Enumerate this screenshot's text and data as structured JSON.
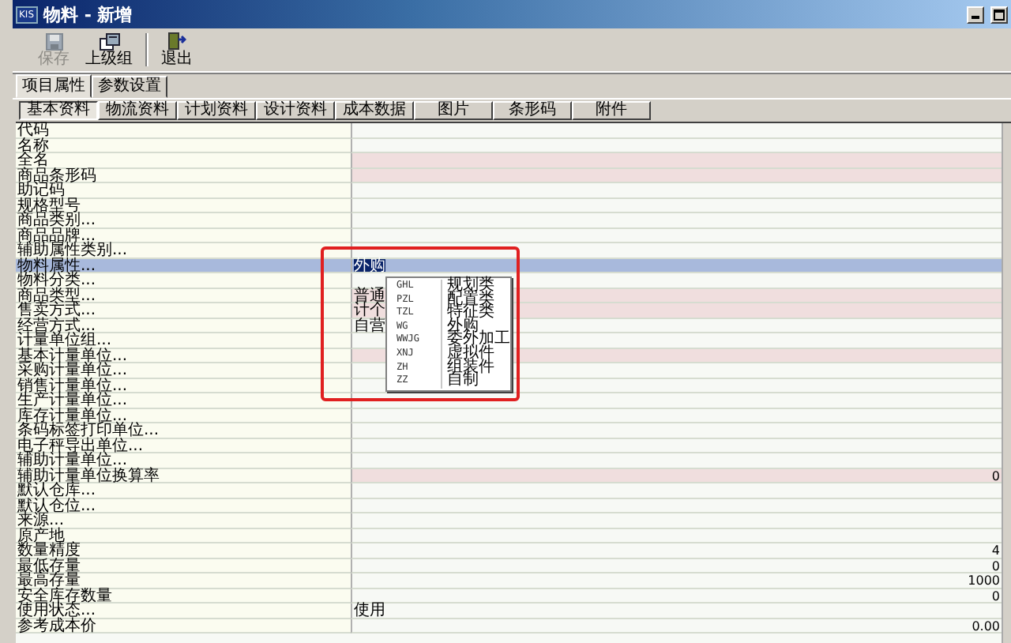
{
  "window": {
    "icon_text": "KIS",
    "title": "物料 - 新增"
  },
  "toolbar": [
    {
      "label": "保存",
      "disabled": true
    },
    {
      "label": "上级组",
      "disabled": false
    },
    {
      "label": "退出",
      "disabled": false
    }
  ],
  "tabs": [
    {
      "label": "项目属性",
      "selected": true
    },
    {
      "label": "参数设置",
      "selected": false
    }
  ],
  "subtabs": [
    {
      "label": "基本资料",
      "selected": true
    },
    {
      "label": "物流资料",
      "selected": false
    },
    {
      "label": "计划资料",
      "selected": false
    },
    {
      "label": "设计资料",
      "selected": false
    },
    {
      "label": "成本数据",
      "selected": false
    },
    {
      "label": "图片",
      "selected": false
    },
    {
      "label": "条形码",
      "selected": false
    },
    {
      "label": "附件",
      "selected": false
    }
  ],
  "fields": [
    {
      "label": "代码",
      "kind": "text",
      "required": false,
      "selected": false
    },
    {
      "label": "名称",
      "kind": "text",
      "required": false,
      "selected": false
    },
    {
      "label": "全名",
      "kind": "text",
      "required": true,
      "selected": false
    },
    {
      "label": "商品条形码",
      "kind": "text",
      "required": true,
      "selected": false
    },
    {
      "label": "助记码",
      "kind": "text",
      "required": false,
      "selected": false
    },
    {
      "label": "规格型号",
      "kind": "text",
      "required": false,
      "selected": false
    },
    {
      "label": "商品类别...",
      "kind": "text",
      "required": false,
      "selected": false
    },
    {
      "label": "商品品牌...",
      "kind": "text",
      "required": false,
      "selected": false
    },
    {
      "label": "辅助属性类别...",
      "kind": "text",
      "required": false,
      "selected": false
    },
    {
      "label": "物料属性...",
      "kind": "text",
      "value": "外购",
      "required": false,
      "selected": true
    },
    {
      "label": "物料分类...",
      "kind": "text",
      "required": false,
      "selected": false
    },
    {
      "label": "商品类型...",
      "kind": "text",
      "value": "普通",
      "required": true,
      "selected": false
    },
    {
      "label": "售卖方式...",
      "kind": "text",
      "value": "计个",
      "required": true,
      "selected": false
    },
    {
      "label": "经营方式...",
      "kind": "text",
      "value": "自营",
      "required": false,
      "selected": false
    },
    {
      "label": "计量单位组...",
      "kind": "text",
      "required": false,
      "selected": false
    },
    {
      "label": "基本计量单位...",
      "kind": "text",
      "required": true,
      "selected": false
    },
    {
      "label": "采购计量单位...",
      "kind": "text",
      "required": false,
      "selected": false
    },
    {
      "label": "销售计量单位...",
      "kind": "text",
      "required": false,
      "selected": false
    },
    {
      "label": "生产计量单位...",
      "kind": "text",
      "required": false,
      "selected": false
    },
    {
      "label": "库存计量单位...",
      "kind": "text",
      "required": false,
      "selected": false
    },
    {
      "label": "条码标签打印单位...",
      "kind": "text",
      "required": false,
      "selected": false
    },
    {
      "label": "电子秤导出单位...",
      "kind": "text",
      "required": false,
      "selected": false
    },
    {
      "label": "辅助计量单位...",
      "kind": "text",
      "required": false,
      "selected": false
    },
    {
      "label": "辅助计量单位换算率",
      "kind": "number",
      "value": "0",
      "required": true,
      "selected": false
    },
    {
      "label": "默认仓库...",
      "kind": "text",
      "required": false,
      "selected": false
    },
    {
      "label": "默认仓位...",
      "kind": "text",
      "required": false,
      "selected": false
    },
    {
      "label": "来源...",
      "kind": "text",
      "required": false,
      "selected": false
    },
    {
      "label": "原产地",
      "kind": "text",
      "required": false,
      "selected": false
    },
    {
      "label": "数量精度",
      "kind": "number",
      "value": "4",
      "required": false,
      "selected": false
    },
    {
      "label": "最低存量",
      "kind": "number",
      "value": "0",
      "required": false,
      "selected": false
    },
    {
      "label": "最高存量",
      "kind": "number",
      "value": "1000",
      "required": false,
      "selected": false
    },
    {
      "label": "安全库存数量",
      "kind": "number",
      "value": "0",
      "required": false,
      "selected": false
    },
    {
      "label": "使用状态...",
      "kind": "text",
      "value": "使用",
      "required": false,
      "selected": false
    },
    {
      "label": "参考成本价",
      "kind": "number",
      "value": "0.00",
      "required": false,
      "selected": false
    }
  ],
  "dropdown": {
    "items": [
      {
        "code": "GHL",
        "name": "规划类"
      },
      {
        "code": "PZL",
        "name": "配置类"
      },
      {
        "code": "TZL",
        "name": "特征类"
      },
      {
        "code": "WG",
        "name": "外购"
      },
      {
        "code": "WWJG",
        "name": "委外加工"
      },
      {
        "code": "XNJ",
        "name": "虚拟件"
      },
      {
        "code": "ZH",
        "name": "组装件"
      },
      {
        "code": "ZZ",
        "name": "自制"
      }
    ]
  }
}
